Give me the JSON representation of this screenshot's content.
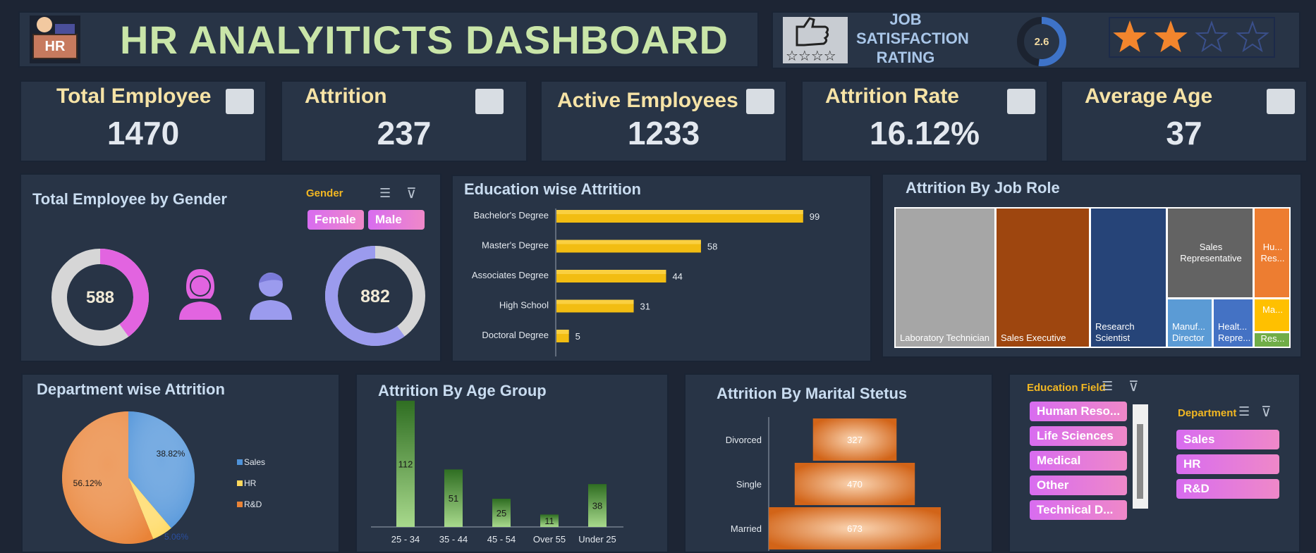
{
  "header": {
    "title": "HR ANALYITICTS DASHBOARD",
    "logo_text": "HR"
  },
  "satisfaction": {
    "label_line1": "JOB",
    "label_line2": "SATISFACTION",
    "label_line3": "RATING",
    "value": "2.6",
    "ratio": 0.52,
    "stars_filled": 2,
    "stars_total": 4
  },
  "kpis": [
    {
      "label": "Total Employee",
      "value": "1470",
      "icon": "people-group-icon"
    },
    {
      "label": "Attrition",
      "value": "237",
      "icon": "people-leaving-icon"
    },
    {
      "label": "Active Employees",
      "value": "1233",
      "icon": "employee-desk-icon"
    },
    {
      "label": "Attrition Rate",
      "value": "16.12%",
      "icon": "percent-person-icon"
    },
    {
      "label": "Average Age",
      "value": "37",
      "icon": "age-icon"
    }
  ],
  "gender": {
    "title": "Total Employee by Gender",
    "slicer_label": "Gender",
    "female_label": "Female",
    "male_label": "Male",
    "female_value": "588",
    "male_value": "882",
    "female_ratio": 0.4,
    "male_ratio": 0.6
  },
  "colors": {
    "female": "#e264e0",
    "male": "#9b9bee",
    "ring_bg": "#d6d6d6",
    "bar": "#f2bd12",
    "age_bar": "#3f8a2e",
    "marital": "#dd7222",
    "sales": "#4f93d9",
    "hr": "#ffd85c",
    "rnd": "#e98337"
  },
  "chart_data": [
    {
      "type": "bar",
      "title": "Education wise Attrition",
      "categories": [
        "Bachelor's Degree",
        "Master's Degree",
        "Associates Degree",
        "High School",
        "Doctoral Degree"
      ],
      "values": [
        99,
        58,
        44,
        31,
        5
      ],
      "xlim": [
        0,
        105
      ]
    },
    {
      "type": "heatmap",
      "title": "Attrition By Job Role",
      "categories": [
        "Laboratory Technician",
        "Sales Executive",
        "Research Scientist",
        "Sales Representative",
        "Manuf... Director",
        "Healt... Repre...",
        "Hu... Res...",
        "Ma...",
        "Res..."
      ]
    },
    {
      "type": "pie",
      "title": "Department wise Attrition",
      "categories": [
        "Sales",
        "HR",
        "R&D"
      ],
      "values": [
        38.82,
        5.06,
        56.12
      ],
      "labels": [
        "38.82%",
        "5.06%",
        "56.12%"
      ]
    },
    {
      "type": "bar",
      "title": "Attrition By Age Group",
      "categories": [
        "25 - 34",
        "35 - 44",
        "45 - 54",
        "Over 55",
        "Under 25"
      ],
      "values": [
        112,
        51,
        25,
        11,
        38
      ],
      "ylim": [
        0,
        115
      ]
    },
    {
      "type": "bar",
      "title": "Attrition By Marital Stetus",
      "categories": [
        "Divorced",
        "Single",
        "Married"
      ],
      "values": [
        327,
        470,
        673
      ]
    }
  ],
  "slicers": {
    "education_field": {
      "label": "Education Field",
      "items": [
        "Human Reso...",
        "Life Sciences",
        "Medical",
        "Other",
        "Technical D..."
      ]
    },
    "department": {
      "label": "Department",
      "items": [
        "Sales",
        "HR",
        "R&D"
      ]
    }
  }
}
